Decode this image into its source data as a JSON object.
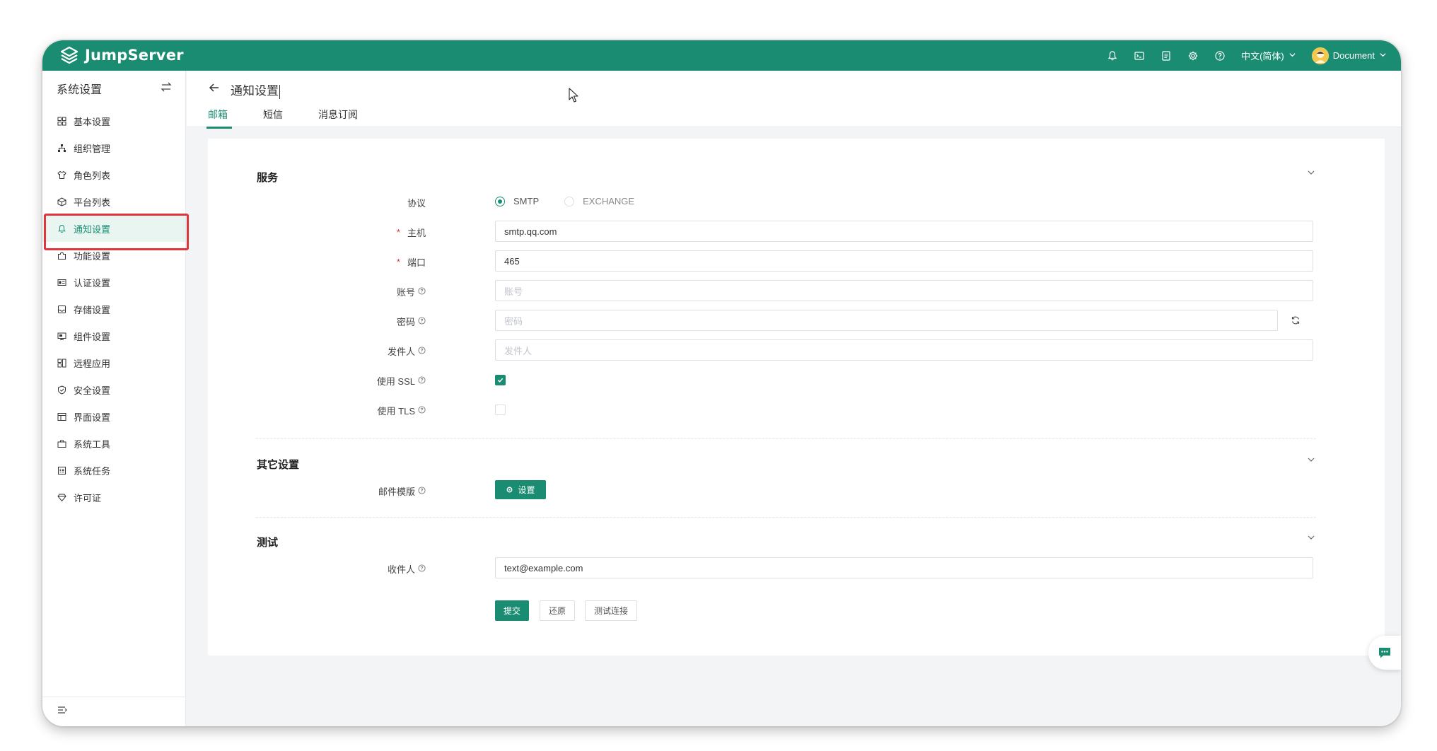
{
  "header": {
    "brand": "JumpServer",
    "language": "中文(简体)",
    "user": "Document",
    "icons": [
      "bell-icon",
      "terminal-icon",
      "document-icon",
      "gear-icon",
      "help-icon"
    ]
  },
  "sidebar": {
    "title": "系统设置",
    "items": [
      {
        "label": "基本设置",
        "icon": "grid-icon"
      },
      {
        "label": "组织管理",
        "icon": "org-icon"
      },
      {
        "label": "角色列表",
        "icon": "shirt-icon"
      },
      {
        "label": "平台列表",
        "icon": "cube-icon"
      },
      {
        "label": "通知设置",
        "icon": "bell-icon"
      },
      {
        "label": "功能设置",
        "icon": "puzzle-icon"
      },
      {
        "label": "认证设置",
        "icon": "id-card-icon"
      },
      {
        "label": "存储设置",
        "icon": "storage-icon"
      },
      {
        "label": "组件设置",
        "icon": "monitor-icon"
      },
      {
        "label": "远程应用",
        "icon": "apps-icon"
      },
      {
        "label": "安全设置",
        "icon": "shield-icon"
      },
      {
        "label": "界面设置",
        "icon": "layout-icon"
      },
      {
        "label": "系统工具",
        "icon": "toolbox-icon"
      },
      {
        "label": "系统任务",
        "icon": "task-icon"
      },
      {
        "label": "许可证",
        "icon": "diamond-icon"
      }
    ],
    "active_index": 4
  },
  "page": {
    "title": "通知设置",
    "tabs": [
      "邮箱",
      "短信",
      "消息订阅"
    ],
    "active_tab": 0
  },
  "form": {
    "service_title": "服务",
    "protocol_label": "协议",
    "protocol_options": [
      "SMTP",
      "EXCHANGE"
    ],
    "protocol_selected": "SMTP",
    "host_label": "主机",
    "host_value": "smtp.qq.com",
    "port_label": "端口",
    "port_value": "465",
    "account_label": "账号",
    "account_placeholder": "账号",
    "password_label": "密码",
    "password_placeholder": "密码",
    "sender_label": "发件人",
    "sender_placeholder": "发件人",
    "ssl_label": "使用 SSL",
    "ssl_checked": true,
    "tls_label": "使用 TLS",
    "tls_checked": false,
    "other_title": "其它设置",
    "template_label": "邮件模版",
    "template_button": "设置",
    "test_title": "测试",
    "recipient_label": "收件人",
    "recipient_value": "text@example.com",
    "submit": "提交",
    "reset": "还原",
    "test_connection": "测试连接"
  },
  "colors": {
    "brand": "#1a8c71",
    "highlight_border": "#e0353b"
  }
}
